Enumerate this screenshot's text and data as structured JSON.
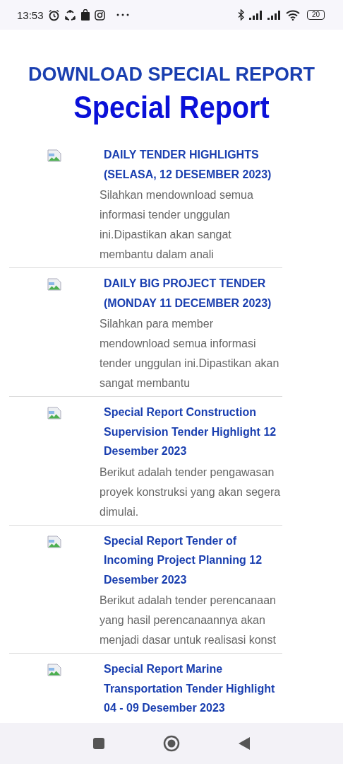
{
  "status_bar": {
    "time": "13:53",
    "battery": "20"
  },
  "header": {
    "kicker": "DOWNLOAD SPECIAL REPORT",
    "title": "Special Report"
  },
  "reports": [
    {
      "title": "DAILY TENDER HIGHLIGHTS (SELASA, 12 DESEMBER 2023)",
      "description": "Silahkan mendownload semua informasi tender unggulan ini.Dipastikan akan sangat membantu dalam anali"
    },
    {
      "title": "DAILY BIG PROJECT TENDER (MONDAY 11 DECEMBER 2023)",
      "description": "Silahkan para member mendownload semua informasi tender unggulan ini.Dipastikan akan sangat membantu"
    },
    {
      "title": "Special Report Construction Supervision Tender Highlight 12 Desember 2023",
      "description": "Berikut adalah tender pengawasan proyek konstruksi yang akan segera dimulai."
    },
    {
      "title": "Special Report Tender of Incoming Project Planning 12 Desember 2023",
      "description": "Berikut adalah tender perencanaan yang hasil perencanaannya akan menjadi dasar untuk realisasi konst"
    },
    {
      "title": "Special Report Marine Transportation Tender Highlight 04 - 09 Desember 2023"
    }
  ]
}
